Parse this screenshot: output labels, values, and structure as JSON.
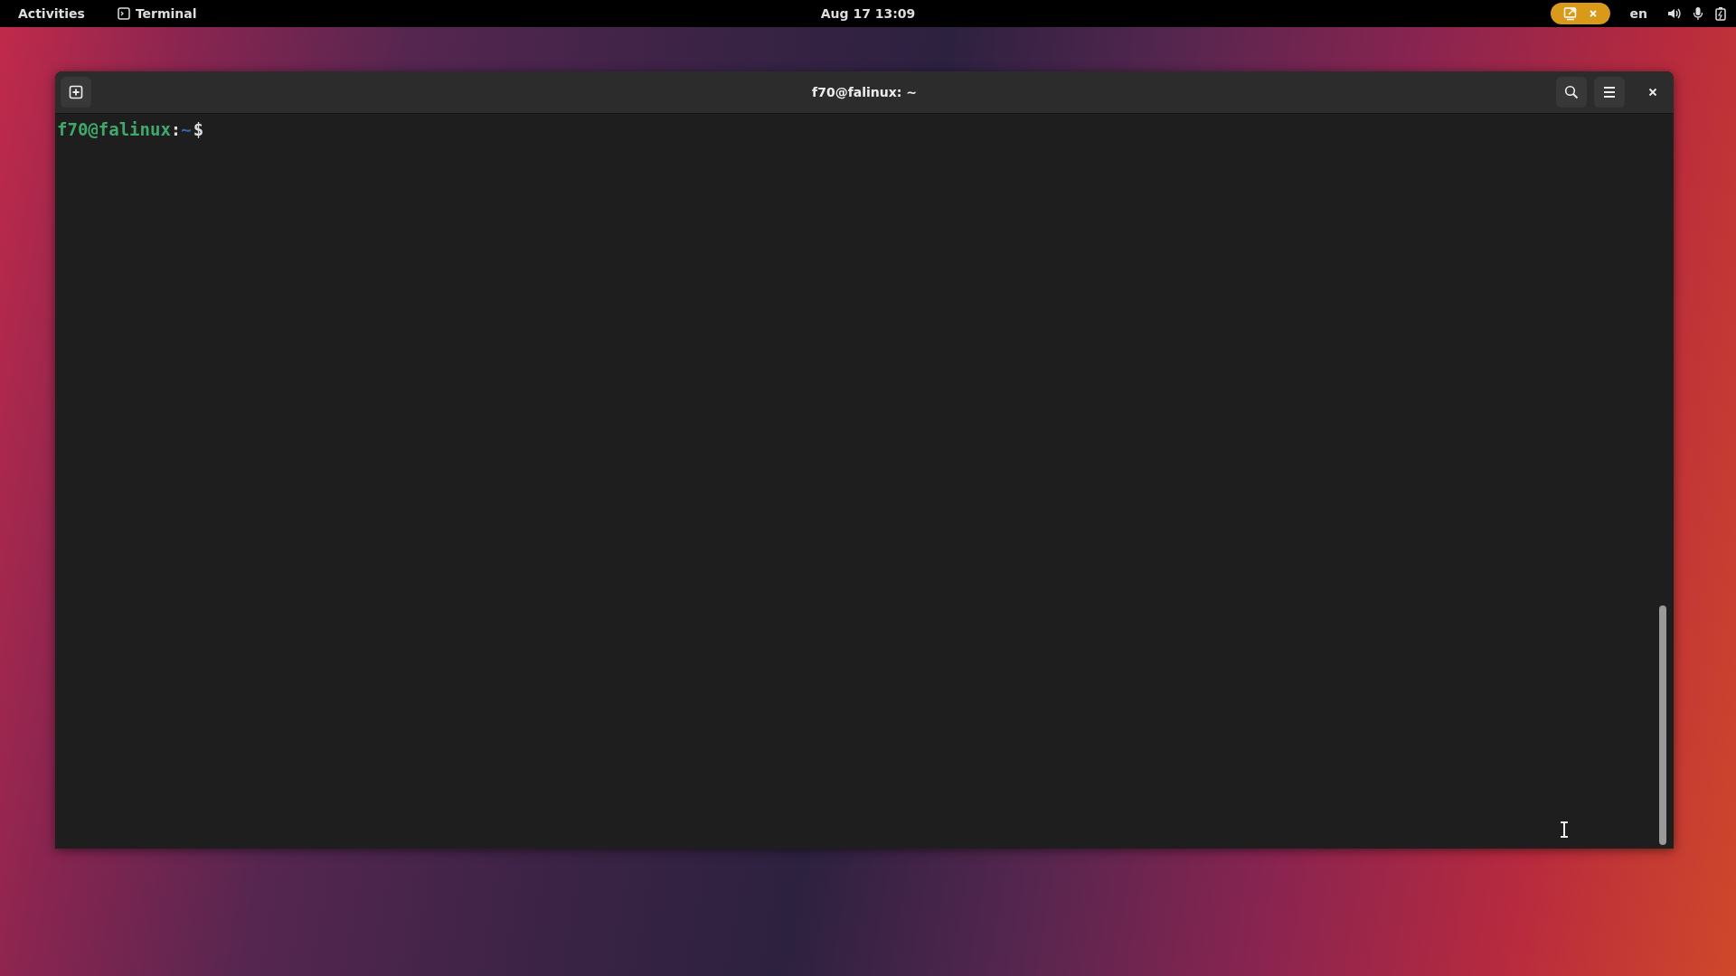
{
  "top_bar": {
    "activities": "Activities",
    "app_name": "Terminal",
    "clock": "Aug 17  13:09",
    "keyboard_layout": "en"
  },
  "window": {
    "title": "f70@falinux: ~",
    "prompt": {
      "user_host": "f70@falinux",
      "separator": ":",
      "path": "~",
      "symbol": "$"
    }
  }
}
